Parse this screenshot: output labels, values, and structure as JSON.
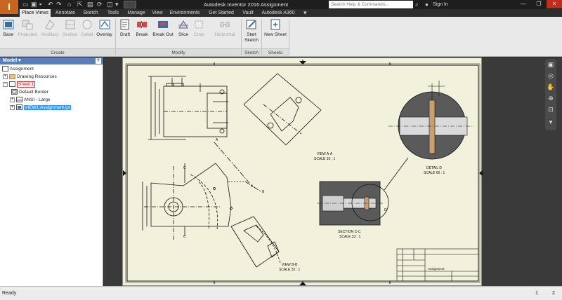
{
  "app": {
    "logo_letter": "I",
    "title": "Autodesk Inventor 2016    Assignment",
    "search_placeholder": "Search Help & Commands...",
    "sign_in": "Sign In"
  },
  "tabs": [
    {
      "label": "Place Views",
      "active": true
    },
    {
      "label": "Annotate",
      "active": false
    },
    {
      "label": "Sketch",
      "active": false
    },
    {
      "label": "Tools",
      "active": false
    },
    {
      "label": "Manage",
      "active": false
    },
    {
      "label": "View",
      "active": false
    },
    {
      "label": "Environments",
      "active": false
    },
    {
      "label": "Get Started",
      "active": false
    },
    {
      "label": "Vault",
      "active": false
    },
    {
      "label": "Autodesk A360",
      "active": false
    }
  ],
  "ribbon": {
    "create": {
      "group_label": "Create",
      "buttons": [
        {
          "label": "Base",
          "enabled": true
        },
        {
          "label": "Projected",
          "enabled": false
        },
        {
          "label": "Auxiliary",
          "enabled": false
        },
        {
          "label": "Section",
          "enabled": false
        },
        {
          "label": "Detail",
          "enabled": false
        },
        {
          "label": "Overlay",
          "enabled": true
        }
      ]
    },
    "modify": {
      "group_label": "Modify",
      "buttons": [
        {
          "label": "Draft",
          "enabled": true
        },
        {
          "label": "Break",
          "enabled": true
        },
        {
          "label": "Break Out",
          "enabled": true
        },
        {
          "label": "Slice",
          "enabled": true
        },
        {
          "label": "Crop",
          "enabled": false
        },
        {
          "label": "Horizontal",
          "enabled": false
        }
      ]
    },
    "sketch": {
      "group_label": "Sketch",
      "button": "Start Sketch"
    },
    "sheets": {
      "group_label": "Sheets",
      "button": "New Sheet"
    }
  },
  "browser": {
    "header": "Model",
    "help": "?",
    "tree": [
      {
        "label": "Assignment",
        "indent": 0
      },
      {
        "label": "Drawing Resources",
        "indent": 1
      },
      {
        "label": "Sheet:1",
        "indent": 1
      },
      {
        "label": "Default Border",
        "indent": 2
      },
      {
        "label": "ANSI - Large",
        "indent": 2
      },
      {
        "label": "VIEW1:Assignment.ipt",
        "indent": 2
      }
    ]
  },
  "drawing": {
    "view_aa": {
      "name": "VIEW A-A",
      "scale": "SCALE 33 : 1"
    },
    "view_bb": {
      "name": "VIEW B-B",
      "scale": "SCALE 32 : 1"
    },
    "section_cc": {
      "name": "SECTION C-C",
      "scale": "SCALE 33 : 1"
    },
    "detail_d": {
      "name": "DETAIL D",
      "scale": "SCALE 66 : 1"
    },
    "labels": {
      "a": "A",
      "b": "B",
      "c": "C",
      "d": "D"
    },
    "title_block_name": "Assignment"
  },
  "status": {
    "text": "Ready",
    "count1": "1",
    "count2": "2"
  },
  "colors": {
    "sheet": "#f1f1dc",
    "section_fill": "#555555",
    "detail_fill": "#c8a070",
    "accent": "#c9661e"
  }
}
